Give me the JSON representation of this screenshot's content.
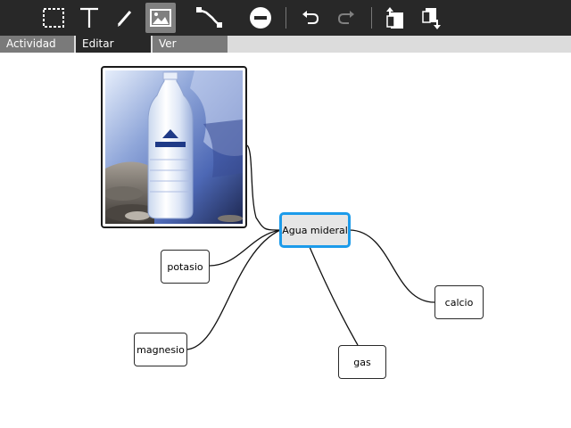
{
  "toolbar": {
    "tools": [
      {
        "name": "select-tool",
        "icon": "dashed-rectangle-icon",
        "active": false
      },
      {
        "name": "text-tool",
        "icon": "text-icon",
        "active": false
      },
      {
        "name": "draw-tool",
        "icon": "pencil-icon",
        "active": false
      },
      {
        "name": "image-tool",
        "icon": "image-icon",
        "active": true
      },
      {
        "name": "link-tool",
        "icon": "connector-icon",
        "active": false
      },
      {
        "name": "delete-tool",
        "icon": "remove-icon",
        "active": false
      },
      {
        "name": "undo",
        "icon": "undo-icon",
        "enabled": true
      },
      {
        "name": "redo",
        "icon": "redo-icon",
        "enabled": false
      },
      {
        "name": "move-up",
        "icon": "layer-up-icon",
        "active": false
      },
      {
        "name": "move-down",
        "icon": "layer-down-icon",
        "active": false
      }
    ]
  },
  "tabs": [
    {
      "label": "Actividad",
      "active": false
    },
    {
      "label": "Editar",
      "active": true
    },
    {
      "label": "Ver",
      "active": false
    }
  ],
  "mindmap": {
    "central": {
      "label": "Agua mideral",
      "selected": true
    },
    "image_node": {
      "description": "water-bottle-photo"
    },
    "children": [
      {
        "label": "potasio"
      },
      {
        "label": "magnesio"
      },
      {
        "label": "gas"
      },
      {
        "label": "calcio"
      }
    ]
  },
  "colors": {
    "toolbar_bg": "#282828",
    "active_tool_bg": "#808080",
    "selection_border": "#1c9bea",
    "tab_inactive": "#7a7a7a",
    "tab_active": "#282828"
  }
}
